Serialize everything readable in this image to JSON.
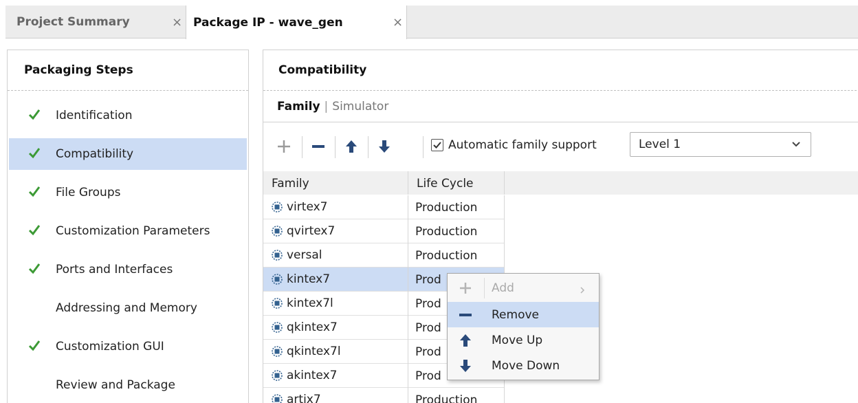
{
  "tabs": [
    {
      "label": "Project Summary",
      "close": "×"
    },
    {
      "label": "Package IP - wave_gen",
      "close": "×"
    }
  ],
  "steps_panel": {
    "title": "Packaging Steps",
    "items": [
      {
        "label": "Identification",
        "checked": true
      },
      {
        "label": "Compatibility",
        "checked": true,
        "selected": true
      },
      {
        "label": "File Groups",
        "checked": true
      },
      {
        "label": "Customization Parameters",
        "checked": true
      },
      {
        "label": "Ports and Interfaces",
        "checked": true
      },
      {
        "label": "Addressing and Memory",
        "checked": false
      },
      {
        "label": "Customization GUI",
        "checked": true
      },
      {
        "label": "Review and Package",
        "checked": false
      }
    ]
  },
  "compat_panel": {
    "title": "Compatibility",
    "subtabs": {
      "active": "Family",
      "separator": "|",
      "inactive": "Simulator"
    },
    "toolbar": {
      "auto_family_label": "Automatic family support",
      "auto_family_checked": true,
      "level_value": "Level 1"
    },
    "table": {
      "headers": [
        "Family",
        "Life Cycle"
      ],
      "rows": [
        {
          "family": "virtex7",
          "lifecycle": "Production"
        },
        {
          "family": "qvirtex7",
          "lifecycle": "Production"
        },
        {
          "family": "versal",
          "lifecycle": "Production"
        },
        {
          "family": "kintex7",
          "lifecycle": "Prod",
          "selected": true
        },
        {
          "family": "kintex7l",
          "lifecycle": "Prod"
        },
        {
          "family": "qkintex7",
          "lifecycle": "Prod"
        },
        {
          "family": "qkintex7l",
          "lifecycle": "Prod"
        },
        {
          "family": "akintex7",
          "lifecycle": "Prod"
        },
        {
          "family": "artix7",
          "lifecycle": "Production"
        }
      ]
    }
  },
  "context_menu": {
    "items": [
      {
        "label": "Add",
        "disabled": true,
        "icon": "plus-icon",
        "submenu_arrow": "▸"
      },
      {
        "label": "Remove",
        "highlighted": true,
        "icon": "minus-icon"
      },
      {
        "label": "Move Up",
        "icon": "arrow-up-icon"
      },
      {
        "label": "Move Down",
        "icon": "arrow-down-icon"
      }
    ]
  },
  "colors": {
    "selection": "#ccdcf4",
    "check_green": "#3c9a35",
    "icon_navy": "#2a4a7a",
    "chip_blue": "#34628f"
  }
}
